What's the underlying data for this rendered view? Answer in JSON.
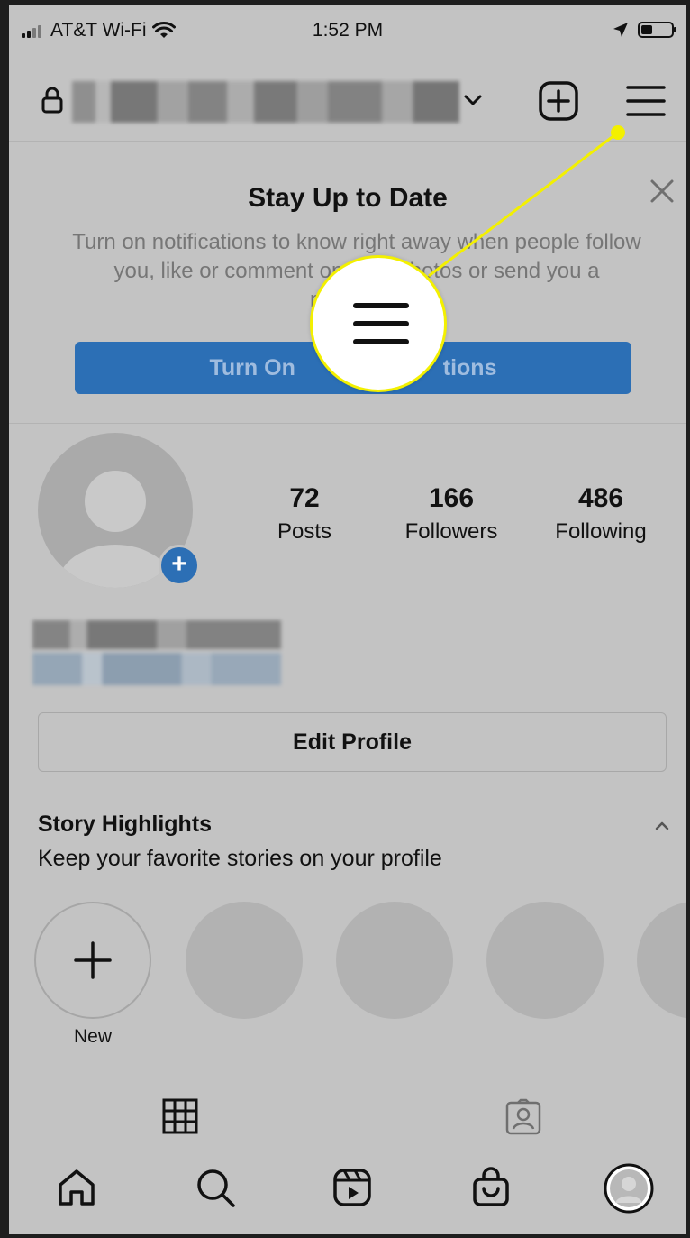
{
  "status_bar": {
    "carrier": "AT&T Wi-Fi",
    "time": "1:52 PM",
    "icons": [
      "signal-icon",
      "wifi-icon",
      "location-arrow-icon",
      "battery-icon"
    ]
  },
  "header": {
    "icons": [
      "lock-icon",
      "chevron-down-icon",
      "new-post-icon",
      "menu-icon"
    ]
  },
  "notification_banner": {
    "title": "Stay Up to Date",
    "body": "Turn on notifications to know right away when people follow you, like or comment on your photos or send you a message.",
    "body_visible": "Turn on notifications to know right away when people follow you, like or comment on your photos or send you a message.",
    "button_label": "Turn On Notifications",
    "button_visible": "Turn On",
    "button_visible_tail": "tions",
    "button_color": "#2c6fb5"
  },
  "profile": {
    "stats": [
      {
        "value": "72",
        "label": "Posts"
      },
      {
        "value": "166",
        "label": "Followers"
      },
      {
        "value": "486",
        "label": "Following"
      }
    ],
    "edit_button": "Edit Profile"
  },
  "story_highlights": {
    "title": "Story Highlights",
    "subtitle": "Keep your favorite stories on your profile",
    "new_label": "New"
  },
  "tabs": [
    "grid-icon",
    "tagged-icon"
  ],
  "bottom_nav": [
    "home-icon",
    "search-icon",
    "reels-icon",
    "shop-icon",
    "profile-avatar-icon"
  ],
  "callout": {
    "color": "#f3f000"
  }
}
